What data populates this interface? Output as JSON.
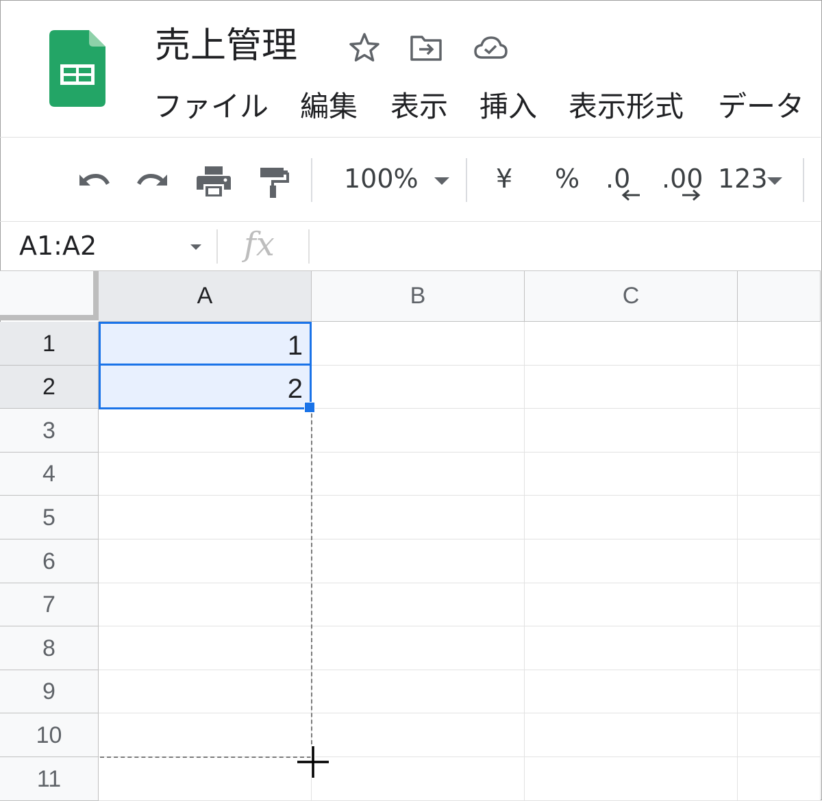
{
  "app": {
    "title": "売上管理",
    "icons": [
      "sheets-logo-icon",
      "star-icon",
      "move-to-folder-icon",
      "cloud-saved-icon"
    ]
  },
  "menu": {
    "items": [
      "ファイル",
      "編集",
      "表示",
      "挿入",
      "表示形式",
      "データ"
    ]
  },
  "toolbar": {
    "icons": [
      "undo-icon",
      "redo-icon",
      "print-icon",
      "paint-format-icon"
    ],
    "zoom": "100%",
    "currency": "¥",
    "percent": "%",
    "decimal_decrease": ".0",
    "decimal_increase": ".00",
    "more_formats": "123"
  },
  "formula_bar": {
    "name_box": "A1:A2",
    "fx_label": "fx",
    "value": ""
  },
  "grid": {
    "columns": [
      "A",
      "B",
      "C",
      ""
    ],
    "rows": [
      "1",
      "2",
      "3",
      "4",
      "5",
      "6",
      "7",
      "8",
      "9",
      "10",
      "11"
    ],
    "cells": {
      "A1": "1",
      "A2": "2"
    },
    "selection": "A1:A2",
    "drag_fill_to": "A10"
  },
  "colors": {
    "selection_border": "#1a73e8",
    "selection_fill": "#e8f0fe",
    "header_bg": "#f8f9fa",
    "header_selected_bg": "#e8eaed",
    "sheets_green": "#23a566"
  }
}
